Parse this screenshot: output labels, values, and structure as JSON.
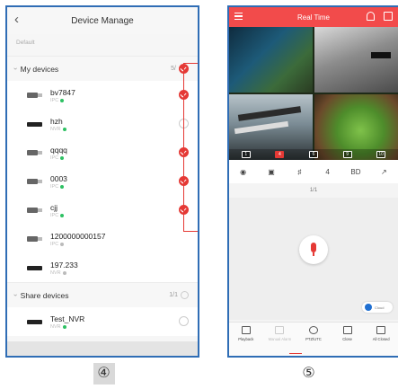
{
  "left_phone": {
    "back_icon": "chevron-left-icon",
    "title": "Device Manage",
    "default_label": "Default",
    "my_devices": {
      "label": "My devices",
      "count": "5/"
    },
    "devices": [
      {
        "name": "bv7847",
        "type_label": "IPC",
        "icon": "camera-icon",
        "online": true,
        "checked": true
      },
      {
        "name": "hzh",
        "type_label": "NVR",
        "icon": "nvr-icon",
        "online": true,
        "checked": false
      },
      {
        "name": "qqqq",
        "type_label": "IPC",
        "icon": "camera-icon",
        "online": true,
        "checked": true
      },
      {
        "name": "0003",
        "type_label": "IPC",
        "icon": "camera-icon",
        "online": true,
        "checked": true
      },
      {
        "name": "cjj",
        "type_label": "IPC",
        "icon": "camera-icon",
        "online": true,
        "checked": true
      },
      {
        "name": "1200000000157",
        "type_label": "IPC",
        "icon": "camera-icon",
        "online": false,
        "checked": null
      },
      {
        "name": "197.233",
        "type_label": "NVR",
        "icon": "nvr-icon",
        "online": false,
        "checked": null
      }
    ],
    "share_devices": {
      "label": "Share devices",
      "count": "1/1"
    },
    "shared": [
      {
        "name": "Test_NVR",
        "type_label": "NVR",
        "icon": "nvr-icon",
        "online": true,
        "checked": false
      }
    ],
    "highlight_color": "#e53935"
  },
  "right_phone": {
    "title": "Real Time",
    "header_color": "#f24b4b",
    "header_icons": [
      "menu-icon",
      "bell-icon",
      "multi-screen-icon"
    ],
    "channel_numbers": [
      "1",
      "4",
      "6",
      "9",
      "10"
    ],
    "toolbar": [
      "snapshot-icon",
      "record-icon",
      "mute-icon",
      "4",
      "BD",
      "fullscreen-icon"
    ],
    "page_indicator": "1/1",
    "cloud_toggle": "Cloud",
    "bottom_nav": [
      {
        "label": "Playback",
        "icon": "playback-icon",
        "dim": false
      },
      {
        "label": "Manual Alarm",
        "icon": "alarm-icon",
        "dim": true
      },
      {
        "label": "PTZ/UTC",
        "icon": "ptz-icon",
        "dim": false
      },
      {
        "label": "Close",
        "icon": "close-icon",
        "dim": false
      },
      {
        "label": "All Closed",
        "icon": "all-closed-icon",
        "dim": false
      }
    ]
  },
  "captions": {
    "left": "④",
    "right": "⑤"
  }
}
